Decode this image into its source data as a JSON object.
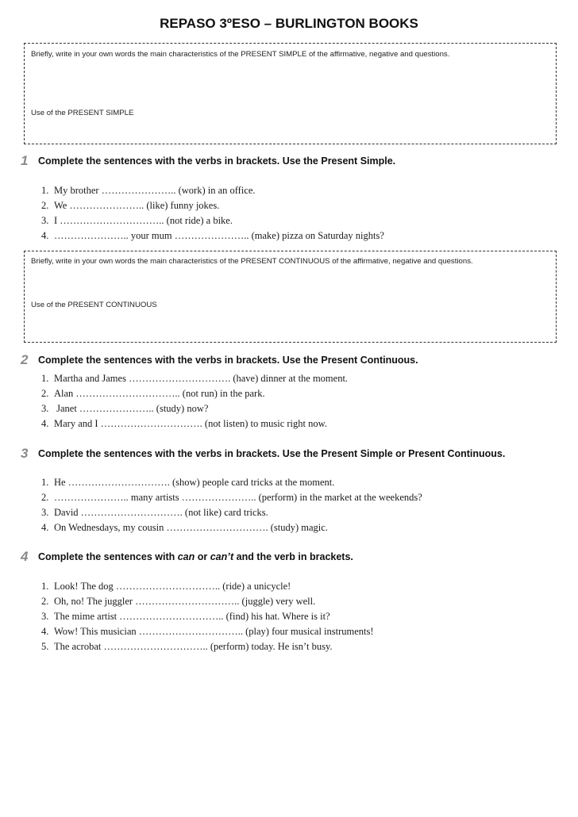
{
  "title": "REPASO 3ºESO – BURLINGTON BOOKS",
  "boxes": [
    {
      "prompt": "Briefly, write in your own words the main characteristics of the PRESENT SIMPLE of the affirmative, negative and questions.",
      "use_label": "Use of the PRESENT SIMPLE"
    },
    {
      "prompt": "Briefly, write in your own words the main characteristics of the PRESENT CONTINUOUS of the affirmative, negative and questions.",
      "use_label": "Use of the PRESENT CONTINUOUS"
    }
  ],
  "exercises": [
    {
      "number": "1",
      "instruction": "Complete the sentences with the verbs in brackets. Use the Present Simple.",
      "items": [
        {
          "n": "1.",
          "text": "My brother ………………….. (work) in an office."
        },
        {
          "n": "2.",
          "text": "We ………………….. (like) funny jokes."
        },
        {
          "n": "3.",
          "text": "I ………………………….. (not ride) a bike."
        },
        {
          "n": "4.",
          "text": "………………….. your mum ………………….. (make) pizza on Saturday nights?"
        }
      ]
    },
    {
      "number": "2",
      "instruction": "Complete the sentences with the verbs in brackets. Use the Present Continuous.",
      "items": [
        {
          "n": "1.",
          "text": "Martha and James …………………………. (have) dinner at the moment."
        },
        {
          "n": "2.",
          "text": "Alan ………………………….. (not run) in the park."
        },
        {
          "n": "3.",
          "text": " Janet ………………….. (study) now?"
        },
        {
          "n": "4.",
          "text": "Mary and I …………………………. (not listen) to music right now."
        }
      ]
    },
    {
      "number": "3",
      "instruction": "Complete the sentences with the verbs in brackets. Use the Present Simple or Present Continuous.",
      "items": [
        {
          "n": "1.",
          "text": "He …………………………. (show) people card tricks at the moment."
        },
        {
          "n": "2.",
          "text": "………………….. many artists ………………….. (perform) in the market at the weekends?"
        },
        {
          "n": "3.",
          "text": "David …………………………. (not like) card tricks."
        },
        {
          "n": "4.",
          "text": "On Wednesdays, my cousin …………………………. (study) magic."
        }
      ]
    },
    {
      "number": "4",
      "instruction_parts": {
        "before": "Complete the sentences with ",
        "em1": "can",
        "mid": " or ",
        "em2": "can’t",
        "after": " and the verb in brackets."
      },
      "items": [
        {
          "n": "1.",
          "text": "Look! The dog ………………………….. (ride) a unicycle!"
        },
        {
          "n": "2.",
          "text": "Oh, no! The juggler ………………………….. (juggle) very well."
        },
        {
          "n": "3.",
          "text": "The mime artist ………………………….. (find) his hat. Where is it?"
        },
        {
          "n": "4.",
          "text": "Wow! This musician ………………………….. (play) four musical instruments!"
        },
        {
          "n": "5.",
          "text": "The acrobat ………………………….. (perform) today. He isn’t busy."
        }
      ]
    }
  ]
}
